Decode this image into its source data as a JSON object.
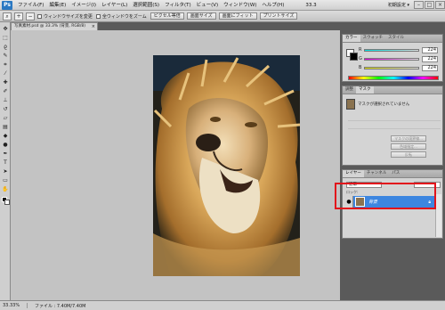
{
  "app": {
    "logo_text": "Ps",
    "menu": [
      "ファイル(F)",
      "編集(E)",
      "イメージ(I)",
      "レイヤー(L)",
      "選択範囲(S)",
      "フィルタ(T)",
      "ビュー(V)",
      "ウィンドウ(W)",
      "ヘルプ(H)"
    ],
    "view_dropdown": "33.3",
    "workspace": "初期設定 ▾"
  },
  "options_bar": {
    "tool_icon": "zoom-icon",
    "check_resize": "ウィンドウサイズを変更",
    "check_all_windows": "全ウィンドウをズーム",
    "btn_actual": "ピクセル等倍",
    "btn_screen": "画面サイズ",
    "btn_fit": "画面にフィット",
    "btn_print": "プリントサイズ"
  },
  "document": {
    "tab_title": "写真素材.psd @ 33.3% (背景, RGB/8)",
    "zoom": "33.33%",
    "file_info": "ファイル : 7.40M/7.40M"
  },
  "color_panel": {
    "tabs": [
      "カラー",
      "スウォッチ",
      "スタイル"
    ],
    "r_label": "R",
    "g_label": "G",
    "b_label": "B",
    "r_value": "224",
    "g_value": "224",
    "b_value": "224"
  },
  "mask_panel": {
    "tabs": [
      "調整",
      "マスク"
    ],
    "label": "マスクが選択されていません",
    "btn_edge": "マスクの境界線...",
    "btn_color": "色域指定...",
    "btn_invert": "反転"
  },
  "layers_panel": {
    "tabs": [
      "レイヤー",
      "チャンネル",
      "パス"
    ],
    "mode": "通常",
    "lock_label": "ロック:",
    "layer_name": "背景"
  },
  "colors": {
    "layer_selected": "#3d86e0",
    "highlight": "#e2131b"
  }
}
